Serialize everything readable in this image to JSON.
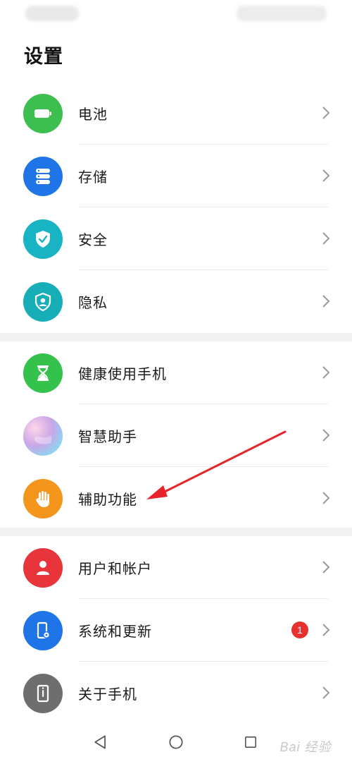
{
  "page": {
    "title": "设置"
  },
  "groups": [
    {
      "items": [
        {
          "label": "电池",
          "icon": "battery-icon",
          "color": "#3dbf4f"
        },
        {
          "label": "存储",
          "icon": "storage-icon",
          "color": "#1f74e8"
        },
        {
          "label": "安全",
          "icon": "shield-check-icon",
          "color": "#18b4c4"
        },
        {
          "label": "隐私",
          "icon": "privacy-icon",
          "color": "#17aeb8"
        }
      ]
    },
    {
      "items": [
        {
          "label": "健康使用手机",
          "icon": "hourglass-icon",
          "color": "#34c24d"
        },
        {
          "label": "智慧助手",
          "icon": "assistant-icon",
          "color": "#c9a6e8"
        },
        {
          "label": "辅助功能",
          "icon": "hand-icon",
          "color": "#f5961c"
        }
      ]
    },
    {
      "items": [
        {
          "label": "用户和帐户",
          "icon": "user-icon",
          "color": "#e8353b"
        },
        {
          "label": "系统和更新",
          "icon": "phone-gear-icon",
          "color": "#1f74e8",
          "badge": "1"
        },
        {
          "label": "关于手机",
          "icon": "phone-info-icon",
          "color": "#6e6e6e"
        }
      ]
    }
  ],
  "nav": {
    "back": "back-icon",
    "home": "home-icon",
    "recent": "recent-apps-icon"
  },
  "watermark": {
    "text": "Bai 经验"
  },
  "annotation": {
    "color": "#e8232a"
  }
}
